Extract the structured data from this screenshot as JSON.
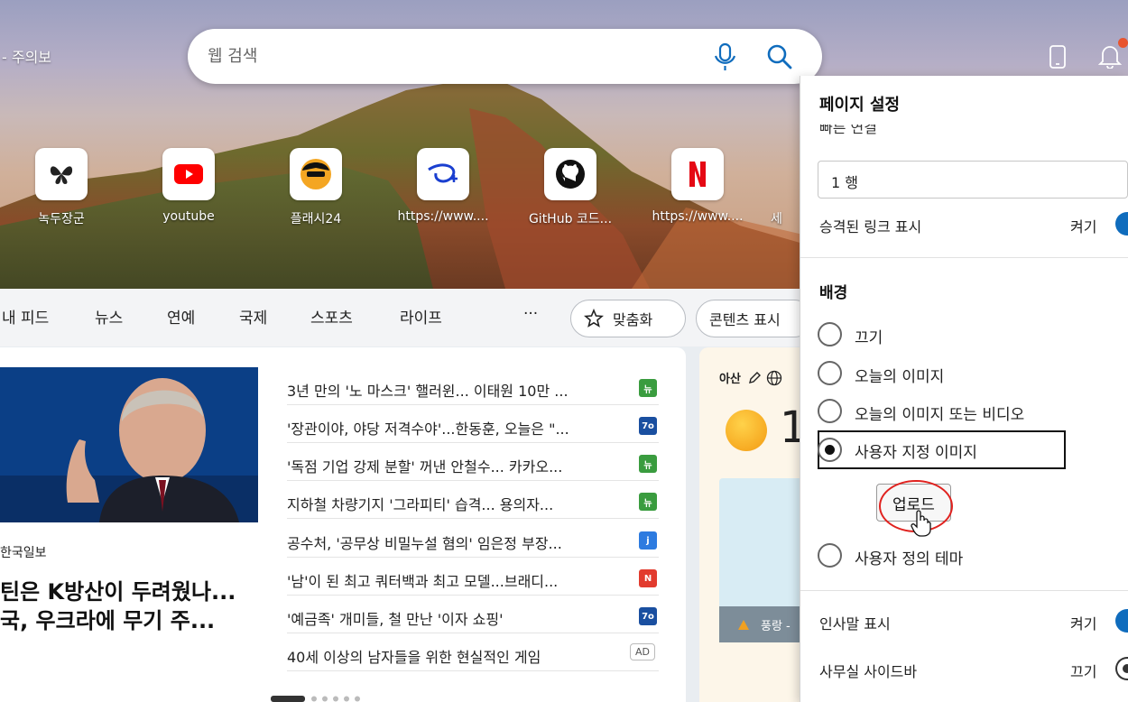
{
  "header": {
    "alert_text": "- 주의보",
    "search_placeholder": "웹 검색"
  },
  "quick_links": [
    {
      "label": "녹두장군",
      "icon": "butterfly-icon"
    },
    {
      "label": "youtube",
      "icon": "youtube-icon"
    },
    {
      "label": "플래시24",
      "icon": "avatar-icon"
    },
    {
      "label": "https://www....",
      "icon": "disney-plus-icon"
    },
    {
      "label": "GitHub 코드...",
      "icon": "github-icon"
    },
    {
      "label": "https://www....",
      "icon": "netflix-icon"
    },
    {
      "label": "세",
      "icon": "partial-tile"
    }
  ],
  "nav": {
    "items": [
      "내 피드",
      "뉴스",
      "연예",
      "국제",
      "스포츠",
      "라이프"
    ],
    "more": "···",
    "personalize_label": "맞춤화",
    "content_label": "콘텐츠 표시"
  },
  "lead_story": {
    "source": "한국일보",
    "title_line1": "틴은 K방산이 두려웠나...",
    "title_line2": "국, 우크라에 무기 주..."
  },
  "headlines": [
    {
      "text": "3년 만의 '노 마스크' 핼러윈... 이태원 10만 ...",
      "src_color": "#3a9c3f",
      "src_text": "뉴"
    },
    {
      "text": "'장관이야, 야당 저격수야'...한동훈, 오늘은 \"...",
      "src_color": "#1a4fa0",
      "src_text": "7o"
    },
    {
      "text": "'독점 기업 강제 분할' 꺼낸 안철수... 카카오...",
      "src_color": "#3a9c3f",
      "src_text": "뉴"
    },
    {
      "text": "지하철 차량기지 '그라피티' 습격... 용의자...",
      "src_color": "#3a9c3f",
      "src_text": "뉴"
    },
    {
      "text": "공수처, '공무상 비밀누설 혐의' 임은정 부장...",
      "src_color": "#2d7be0",
      "src_text": "j"
    },
    {
      "text": "'남'이 된 최고 쿼터백과 최고 모델...브래디...",
      "src_color": "#e23b2e",
      "src_text": "N"
    },
    {
      "text": "'예금족' 개미들, 철 만난 '이자 쇼핑'",
      "src_color": "#1a4fa0",
      "src_text": "7o"
    },
    {
      "text": "40세 이상의 남자들을 위한 현실적인 게임",
      "ad": "AD"
    }
  ],
  "weather": {
    "location": "아산",
    "temp": "1",
    "warning": "풍랑 -"
  },
  "settings": {
    "title": "페이지 설정",
    "quick_links_heading": "빠른 연결",
    "rows_value": "1 행",
    "promoted_links_label": "승격된 링크 표시",
    "promoted_links_value": "켜기",
    "background_heading": "배경",
    "background_options": [
      "끄기",
      "오늘의 이미지",
      "오늘의 이미지 또는 비디오",
      "사용자 지정 이미지"
    ],
    "selected_index": 3,
    "upload_label": "업로드",
    "custom_theme_label": "사용자 정의 테마",
    "greeting_label": "인사말 표시",
    "greeting_value": "켜기",
    "office_sidebar_label": "사무실 사이드바",
    "office_sidebar_value": "끄기"
  },
  "colors": {
    "accent": "#0f6cbd",
    "annotation_red": "#e0221f"
  }
}
